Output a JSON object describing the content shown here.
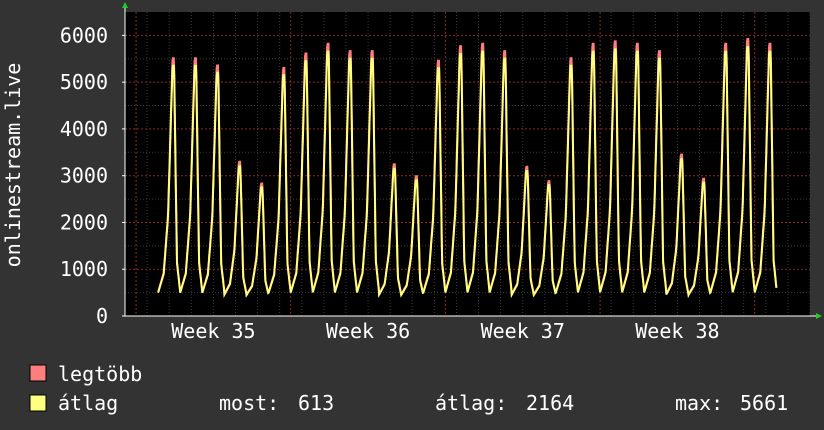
{
  "chart_data": {
    "type": "line",
    "ylabel": "onlinestream.live",
    "ylim": [
      0,
      6500
    ],
    "yticks": [
      0,
      1000,
      2000,
      3000,
      4000,
      5000,
      6000
    ],
    "grid": true,
    "x_tick_labels": [
      "Week 35",
      "Week 36",
      "Week 37",
      "Week 38"
    ],
    "x_axis": "days since start of plot (Week 35 label near day 1.5, Week 36 near day 8.5 ...)",
    "x_range_days": [
      0,
      31
    ],
    "daily_peaks": [
      5350,
      5350,
      5200,
      3200,
      2750,
      5150,
      5450,
      5650,
      5500,
      5500,
      3150,
      2900,
      5300,
      5600,
      5650,
      5500,
      3100,
      2800,
      5350,
      5650,
      5700,
      5650,
      5500,
      3350,
      2850,
      5650,
      5750,
      5650
    ],
    "troughs_min": 400,
    "series": [
      {
        "name": "legtöbb",
        "color": "#ff7f7f",
        "kind": "max"
      },
      {
        "name": "átlag",
        "color": "#ffff7f",
        "kind": "avg"
      }
    ],
    "stats": {
      "most_label": "most:",
      "most_value": "613",
      "atlag_label": "átlag:",
      "atlag_value": "2164",
      "max_label": "max:",
      "max_value": "5661"
    }
  },
  "legend": {
    "max_label": "legtöbb",
    "avg_label": "átlag"
  }
}
